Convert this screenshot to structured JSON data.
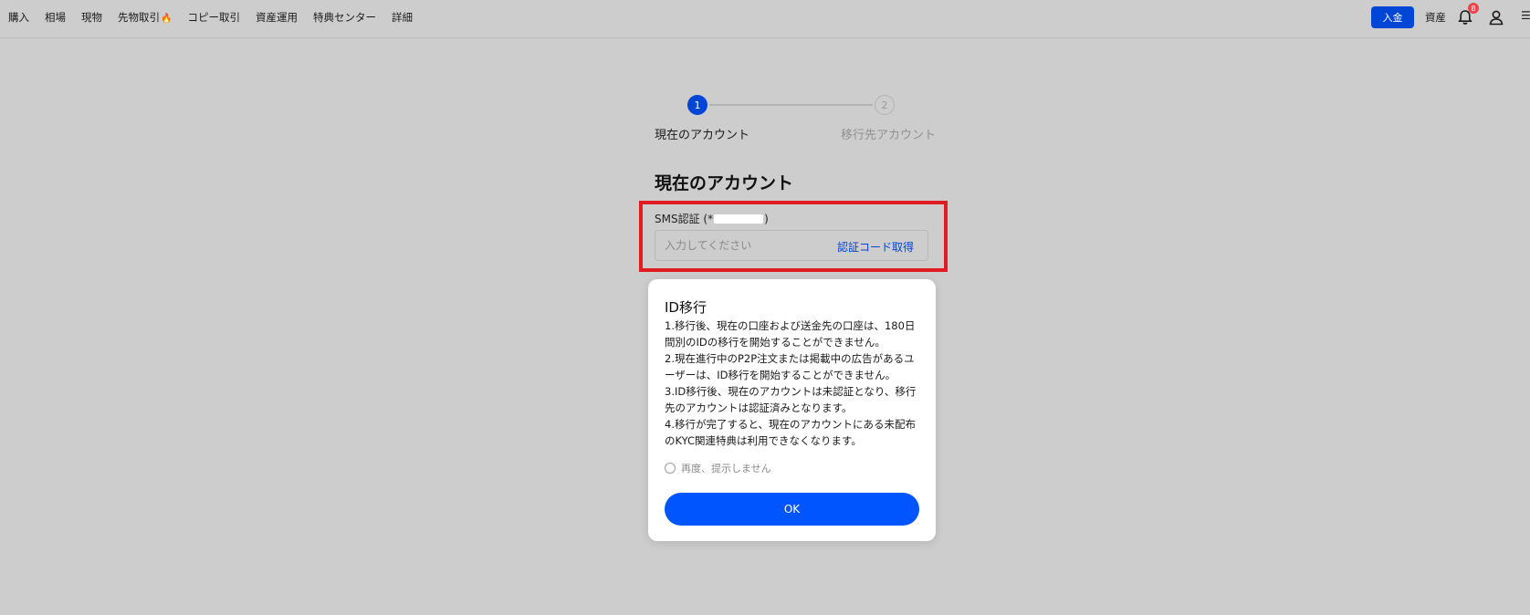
{
  "header": {
    "nav": [
      "購入",
      "相場",
      "現物",
      "先物取引",
      "コピー取引",
      "資産運用",
      "特典センター",
      "詳細"
    ],
    "deposit_label": "入金",
    "assets_label": "資産",
    "notification_count": "8"
  },
  "stepper": {
    "steps": [
      {
        "number": "1",
        "label": "現在のアカウント"
      },
      {
        "number": "2",
        "label": "移行先アカウント"
      }
    ],
    "active_step": 1
  },
  "page": {
    "title": "現在のアカウント"
  },
  "sms": {
    "label_prefix": "SMS認証 (*",
    "label_suffix": ")",
    "placeholder": "入力してください",
    "get_code_label": "認証コード取得"
  },
  "modal": {
    "title": "ID移行",
    "paragraphs": [
      "1.移行後、現在の口座および送金先の口座は、180日間別のIDの移行を開始することができません。",
      "2.現在進行中のP2P注文または掲載中の広告があるユーザーは、ID移行を開始することができません。",
      "3.ID移行後、現在のアカウントは未認証となり、移行先のアカウントは認証済みとなります。",
      "4.移行が完了すると、現在のアカウントにある未配布のKYC関連特典は利用できなくなります。"
    ],
    "dont_show_label": "再度、提示しません",
    "ok_label": "OK"
  },
  "colors": {
    "primary": "#0046d6",
    "ok_button": "#0055ff",
    "highlight_border": "#e11b22",
    "overlay_bg": "#cdcdcd"
  }
}
